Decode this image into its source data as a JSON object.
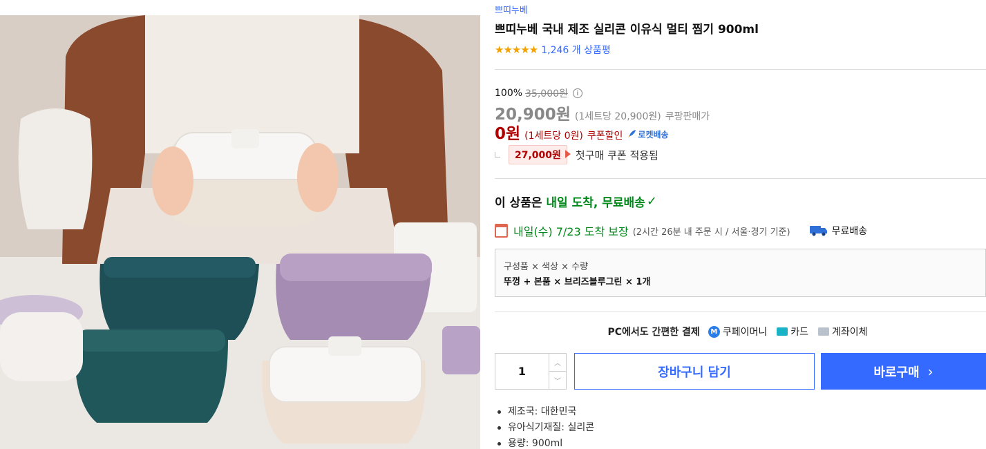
{
  "product": {
    "brand": "쁘띠누베",
    "title": "쁘띠누베 국내 제조 실리콘 이유식 멀티 찜기 900ml",
    "stars": "★★★★★",
    "review_count": "1,246 개 상품평"
  },
  "price": {
    "discount_rate": "100%",
    "original_price": "35,000원",
    "info_icon": "i",
    "sale_price": "20,900원",
    "sale_unit": "(1세트당 20,900원)",
    "sale_label": "쿠팡판매가",
    "coupon_price": "0원",
    "coupon_unit": "(1세트당 0원)",
    "coupon_label": "쿠폰할인",
    "rocket_label": "로켓배송",
    "first_price": "27,000원",
    "first_label": "첫구매 쿠폰 적용됨"
  },
  "delivery": {
    "title_prefix": "이 상품은",
    "title_highlight": "내일 도착, 무료배송",
    "check": "✓",
    "guarantee_main": "내일(수) 7/23 도착 보장",
    "guarantee_sub": "(2시간 26분 내 주문 시 / 서울·경기 기준)",
    "free_shipping": "무료배송"
  },
  "option": {
    "label": "구성품 × 색상 × 수량",
    "value": "뚜껑 + 본품 × 브리즈블루그린 × 1개"
  },
  "payment": {
    "title": "PC에서도 간편한 결제",
    "coupay_icon": "M",
    "coupay": "쿠페이머니",
    "card": "카드",
    "bank": "계좌이체"
  },
  "purchase": {
    "quantity": "1",
    "up_arrow": "︿",
    "down_arrow": "﹀",
    "cart_label": "장바구니 담기",
    "buy_label": "바로구매",
    "buy_chevron": "›"
  },
  "specs": [
    "제조국: 대한민국",
    "유아식기재질: 실리콘",
    "용량: 900ml"
  ],
  "colors": {
    "accent": "#346aff",
    "coupon_red": "#ae0000",
    "delivery_green": "#00891a",
    "star": "#f3a200"
  }
}
